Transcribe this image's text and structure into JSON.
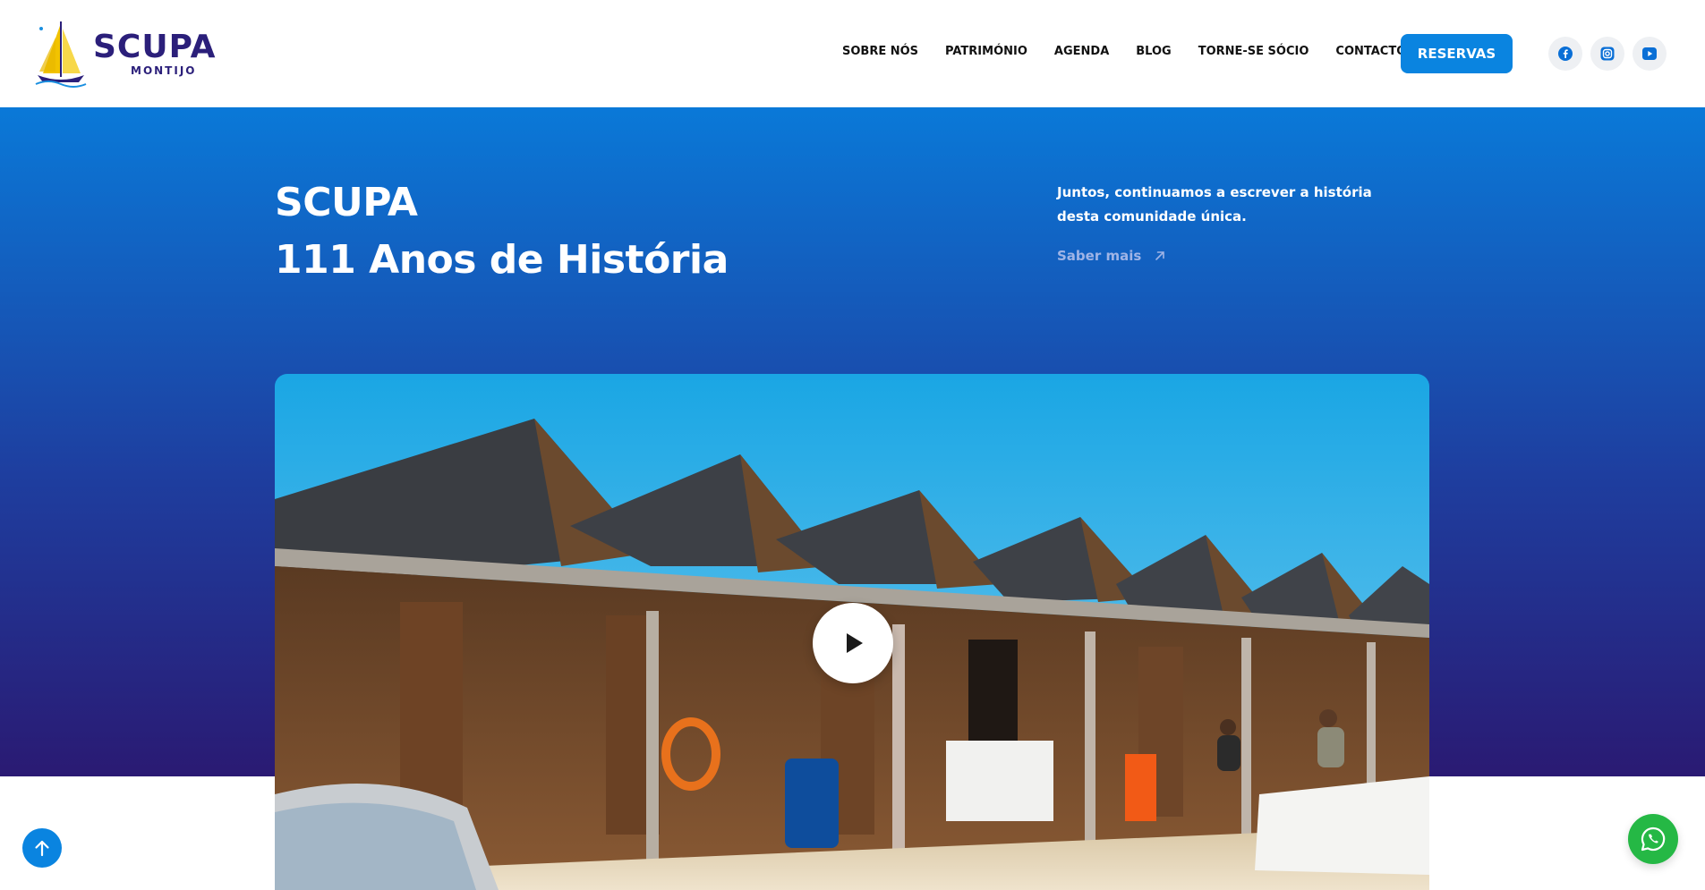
{
  "logo": {
    "title": "SCUPA",
    "subtitle": "MONTIJO"
  },
  "nav": {
    "items": [
      "SOBRE NÓS",
      "PATRIMÓNIO",
      "AGENDA",
      "BLOG",
      "TORNE-SE SÓCIO",
      "CONTACTOS"
    ]
  },
  "header": {
    "reservas_label": "RESERVAS"
  },
  "social": [
    "facebook-icon",
    "instagram-icon",
    "youtube-icon"
  ],
  "hero": {
    "title_line1": "SCUPA",
    "title_line2": "111 Anos de História",
    "text": "Juntos, continuamos a escrever a história desta comunidade única.",
    "link_label": "Saber mais"
  },
  "colors": {
    "accent": "#0a84e0",
    "brand": "#2b1f7a",
    "hero_top": "#0a79d8",
    "hero_bottom": "#2a1a73",
    "whatsapp": "#25b845"
  }
}
